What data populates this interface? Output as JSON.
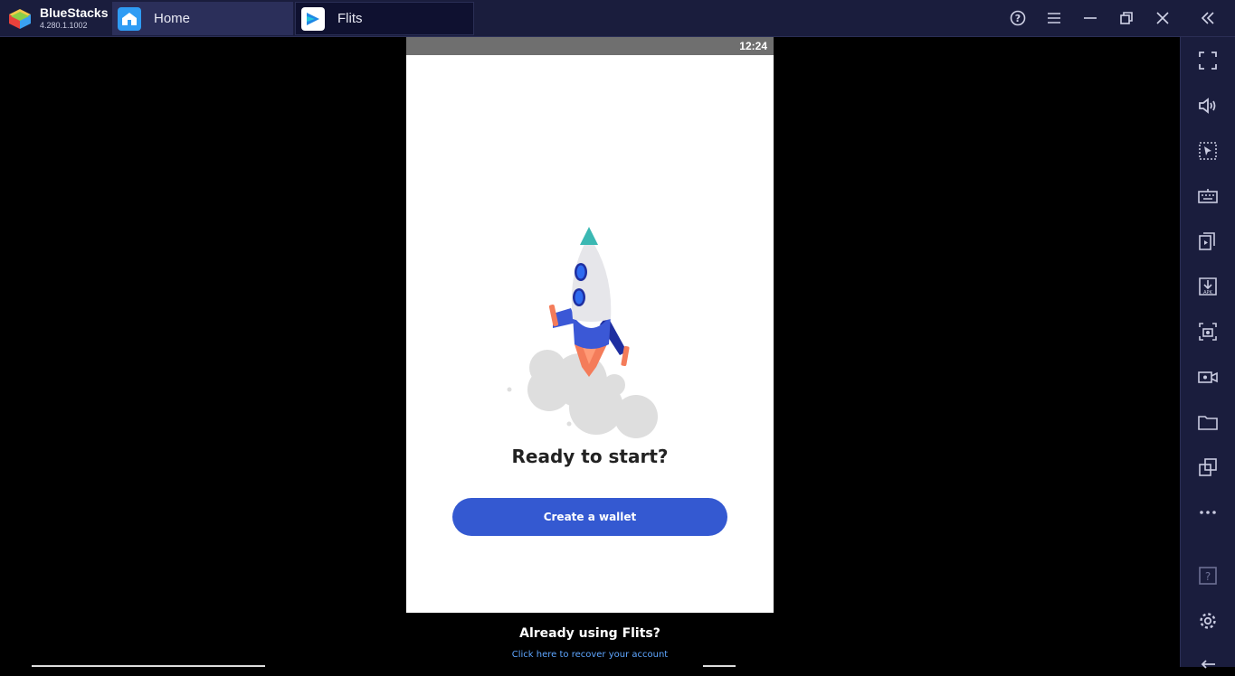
{
  "app": {
    "brand_name": "BlueStacks",
    "version": "4.280.1.1002"
  },
  "tabs": [
    {
      "label": "Home",
      "icon": "home-icon"
    },
    {
      "label": "Flits",
      "icon": "flits-app-icon"
    }
  ],
  "window_controls": [
    "help-icon",
    "menu-icon",
    "minimize-icon",
    "restore-icon",
    "close-icon",
    "collapse-sidebar-icon"
  ],
  "sidebar": {
    "items": [
      "fullscreen-icon",
      "volume-icon",
      "select-region-icon",
      "keyboard-icon",
      "multi-instance-icon",
      "install-apk-icon",
      "screenshot-icon",
      "record-icon",
      "folder-icon",
      "multi-window-icon",
      "more-icon",
      "help-icon",
      "settings-icon",
      "back-icon"
    ]
  },
  "phone": {
    "time": "12:24",
    "headline": "Ready to start?",
    "create_button": "Create a wallet",
    "already_using": "Already using Flits?",
    "recover_link": "Click here to recover your account"
  },
  "colors": {
    "titlebar": "#1a1d3d",
    "accent_button": "#3459d1",
    "link": "#5ea6ff"
  }
}
